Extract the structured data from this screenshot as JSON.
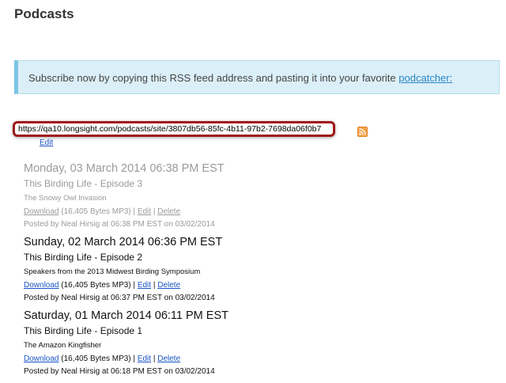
{
  "page": {
    "title": "Podcasts"
  },
  "info": {
    "message": "Subscribe now by copying this RSS feed address and pasting it into your favorite",
    "link_label": "podcatcher:"
  },
  "feed": {
    "url": "https://qa10.longsight.com/podcasts/site/3807db56-85fc-4b11-97b2-7698da06f0b7",
    "edit_label": "Edit",
    "rss_icon": "rss-icon"
  },
  "episodes": [
    {
      "date": "Monday, 03 March 2014 06:38 PM EST",
      "title": "This Birding Life - Episode 3",
      "description": "The Snowy Owl Invasion",
      "download_label": "Download",
      "size": "(16,405 Bytes MP3)",
      "edit_label": "Edit",
      "delete_label": "Delete",
      "posted": "Posted by Neal Hirsig at 06:38 PM EST on 03/02/2014",
      "hidden": true
    },
    {
      "date": "Sunday, 02 March 2014 06:36 PM EST",
      "title": "This Birding Life - Episode 2",
      "description": "Speakers from the 2013 Midwest Birding Symposium",
      "download_label": "Download",
      "size": "(16,405 Bytes MP3)",
      "edit_label": "Edit",
      "delete_label": "Delete",
      "posted": "Posted by Neal Hirsig at 06:37 PM EST on 03/02/2014",
      "hidden": false
    },
    {
      "date": "Saturday, 01 March 2014 06:11 PM EST",
      "title": "This Birding Life - Episode 1",
      "description": "The Amazon Kingfisher",
      "download_label": "Download",
      "size": "(16,405 Bytes MP3)",
      "edit_label": "Edit",
      "delete_label": "Delete",
      "posted": "Posted by Neal Hirsig at 06:18 PM EST on 03/02/2014",
      "hidden": false
    }
  ],
  "separator": "|"
}
